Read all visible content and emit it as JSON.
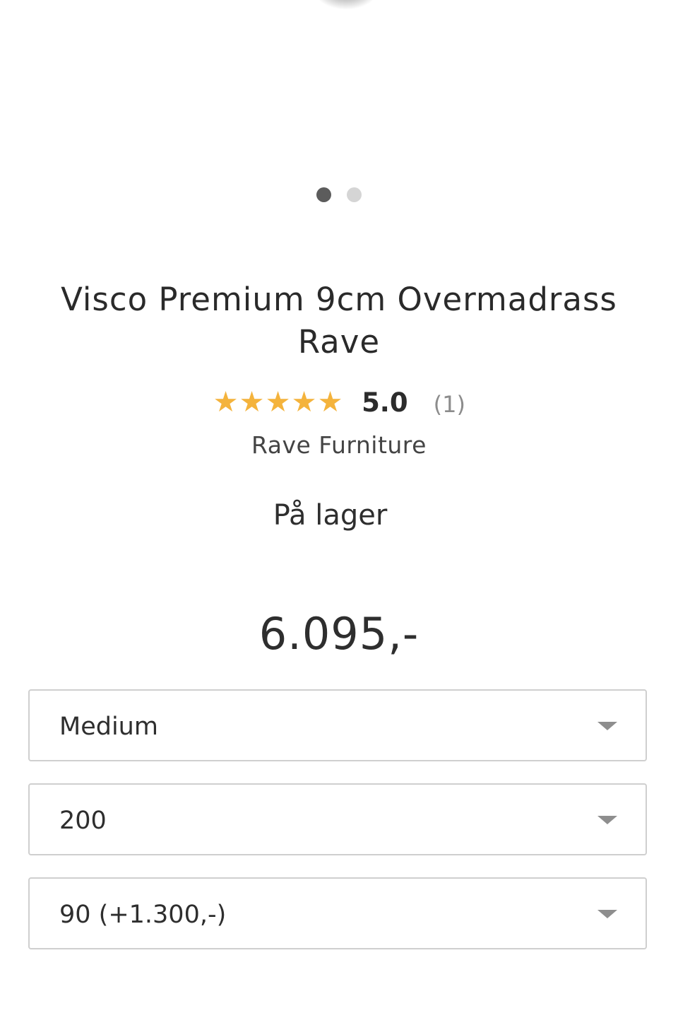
{
  "carousel": {
    "slides_total": 2,
    "active_slide": 1
  },
  "product": {
    "title": "Visco Premium 9cm Overmadrass Rave",
    "rating": {
      "stars": 5,
      "value": "5.0",
      "count": "(1)",
      "star_color": "#f4b33c"
    },
    "brand": "Rave Furniture",
    "stock_status": "På lager",
    "price": "6.095,-"
  },
  "options": {
    "firmness": {
      "selected": "Medium"
    },
    "length": {
      "selected": "200"
    },
    "width": {
      "selected": "90 (+1.300,-)"
    }
  },
  "icons": {
    "star": "star-icon",
    "caret": "chevron-down-icon"
  }
}
